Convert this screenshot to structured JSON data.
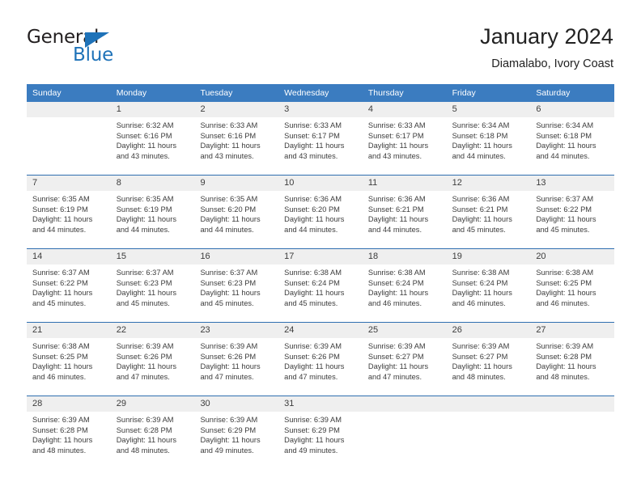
{
  "brand": {
    "name_part1": "General",
    "name_part2": "Blue",
    "accent_color": "#1e72b8"
  },
  "header": {
    "title": "January 2024",
    "subtitle": "Diamalabo, Ivory Coast"
  },
  "theme": {
    "header_blue": "#3b7cc0",
    "divider_blue": "#2f6fb0",
    "day_band_gray": "#efefef",
    "text_color": "#3c3c3c"
  },
  "weekdays": [
    "Sunday",
    "Monday",
    "Tuesday",
    "Wednesday",
    "Thursday",
    "Friday",
    "Saturday"
  ],
  "weeks": [
    [
      {
        "day": "",
        "sunrise": "",
        "sunset": "",
        "daylight_line1": "",
        "daylight_line2": ""
      },
      {
        "day": "1",
        "sunrise": "Sunrise: 6:32 AM",
        "sunset": "Sunset: 6:16 PM",
        "daylight_line1": "Daylight: 11 hours",
        "daylight_line2": "and 43 minutes."
      },
      {
        "day": "2",
        "sunrise": "Sunrise: 6:33 AM",
        "sunset": "Sunset: 6:16 PM",
        "daylight_line1": "Daylight: 11 hours",
        "daylight_line2": "and 43 minutes."
      },
      {
        "day": "3",
        "sunrise": "Sunrise: 6:33 AM",
        "sunset": "Sunset: 6:17 PM",
        "daylight_line1": "Daylight: 11 hours",
        "daylight_line2": "and 43 minutes."
      },
      {
        "day": "4",
        "sunrise": "Sunrise: 6:33 AM",
        "sunset": "Sunset: 6:17 PM",
        "daylight_line1": "Daylight: 11 hours",
        "daylight_line2": "and 43 minutes."
      },
      {
        "day": "5",
        "sunrise": "Sunrise: 6:34 AM",
        "sunset": "Sunset: 6:18 PM",
        "daylight_line1": "Daylight: 11 hours",
        "daylight_line2": "and 44 minutes."
      },
      {
        "day": "6",
        "sunrise": "Sunrise: 6:34 AM",
        "sunset": "Sunset: 6:18 PM",
        "daylight_line1": "Daylight: 11 hours",
        "daylight_line2": "and 44 minutes."
      }
    ],
    [
      {
        "day": "7",
        "sunrise": "Sunrise: 6:35 AM",
        "sunset": "Sunset: 6:19 PM",
        "daylight_line1": "Daylight: 11 hours",
        "daylight_line2": "and 44 minutes."
      },
      {
        "day": "8",
        "sunrise": "Sunrise: 6:35 AM",
        "sunset": "Sunset: 6:19 PM",
        "daylight_line1": "Daylight: 11 hours",
        "daylight_line2": "and 44 minutes."
      },
      {
        "day": "9",
        "sunrise": "Sunrise: 6:35 AM",
        "sunset": "Sunset: 6:20 PM",
        "daylight_line1": "Daylight: 11 hours",
        "daylight_line2": "and 44 minutes."
      },
      {
        "day": "10",
        "sunrise": "Sunrise: 6:36 AM",
        "sunset": "Sunset: 6:20 PM",
        "daylight_line1": "Daylight: 11 hours",
        "daylight_line2": "and 44 minutes."
      },
      {
        "day": "11",
        "sunrise": "Sunrise: 6:36 AM",
        "sunset": "Sunset: 6:21 PM",
        "daylight_line1": "Daylight: 11 hours",
        "daylight_line2": "and 44 minutes."
      },
      {
        "day": "12",
        "sunrise": "Sunrise: 6:36 AM",
        "sunset": "Sunset: 6:21 PM",
        "daylight_line1": "Daylight: 11 hours",
        "daylight_line2": "and 45 minutes."
      },
      {
        "day": "13",
        "sunrise": "Sunrise: 6:37 AM",
        "sunset": "Sunset: 6:22 PM",
        "daylight_line1": "Daylight: 11 hours",
        "daylight_line2": "and 45 minutes."
      }
    ],
    [
      {
        "day": "14",
        "sunrise": "Sunrise: 6:37 AM",
        "sunset": "Sunset: 6:22 PM",
        "daylight_line1": "Daylight: 11 hours",
        "daylight_line2": "and 45 minutes."
      },
      {
        "day": "15",
        "sunrise": "Sunrise: 6:37 AM",
        "sunset": "Sunset: 6:23 PM",
        "daylight_line1": "Daylight: 11 hours",
        "daylight_line2": "and 45 minutes."
      },
      {
        "day": "16",
        "sunrise": "Sunrise: 6:37 AM",
        "sunset": "Sunset: 6:23 PM",
        "daylight_line1": "Daylight: 11 hours",
        "daylight_line2": "and 45 minutes."
      },
      {
        "day": "17",
        "sunrise": "Sunrise: 6:38 AM",
        "sunset": "Sunset: 6:24 PM",
        "daylight_line1": "Daylight: 11 hours",
        "daylight_line2": "and 45 minutes."
      },
      {
        "day": "18",
        "sunrise": "Sunrise: 6:38 AM",
        "sunset": "Sunset: 6:24 PM",
        "daylight_line1": "Daylight: 11 hours",
        "daylight_line2": "and 46 minutes."
      },
      {
        "day": "19",
        "sunrise": "Sunrise: 6:38 AM",
        "sunset": "Sunset: 6:24 PM",
        "daylight_line1": "Daylight: 11 hours",
        "daylight_line2": "and 46 minutes."
      },
      {
        "day": "20",
        "sunrise": "Sunrise: 6:38 AM",
        "sunset": "Sunset: 6:25 PM",
        "daylight_line1": "Daylight: 11 hours",
        "daylight_line2": "and 46 minutes."
      }
    ],
    [
      {
        "day": "21",
        "sunrise": "Sunrise: 6:38 AM",
        "sunset": "Sunset: 6:25 PM",
        "daylight_line1": "Daylight: 11 hours",
        "daylight_line2": "and 46 minutes."
      },
      {
        "day": "22",
        "sunrise": "Sunrise: 6:39 AM",
        "sunset": "Sunset: 6:26 PM",
        "daylight_line1": "Daylight: 11 hours",
        "daylight_line2": "and 47 minutes."
      },
      {
        "day": "23",
        "sunrise": "Sunrise: 6:39 AM",
        "sunset": "Sunset: 6:26 PM",
        "daylight_line1": "Daylight: 11 hours",
        "daylight_line2": "and 47 minutes."
      },
      {
        "day": "24",
        "sunrise": "Sunrise: 6:39 AM",
        "sunset": "Sunset: 6:26 PM",
        "daylight_line1": "Daylight: 11 hours",
        "daylight_line2": "and 47 minutes."
      },
      {
        "day": "25",
        "sunrise": "Sunrise: 6:39 AM",
        "sunset": "Sunset: 6:27 PM",
        "daylight_line1": "Daylight: 11 hours",
        "daylight_line2": "and 47 minutes."
      },
      {
        "day": "26",
        "sunrise": "Sunrise: 6:39 AM",
        "sunset": "Sunset: 6:27 PM",
        "daylight_line1": "Daylight: 11 hours",
        "daylight_line2": "and 48 minutes."
      },
      {
        "day": "27",
        "sunrise": "Sunrise: 6:39 AM",
        "sunset": "Sunset: 6:28 PM",
        "daylight_line1": "Daylight: 11 hours",
        "daylight_line2": "and 48 minutes."
      }
    ],
    [
      {
        "day": "28",
        "sunrise": "Sunrise: 6:39 AM",
        "sunset": "Sunset: 6:28 PM",
        "daylight_line1": "Daylight: 11 hours",
        "daylight_line2": "and 48 minutes."
      },
      {
        "day": "29",
        "sunrise": "Sunrise: 6:39 AM",
        "sunset": "Sunset: 6:28 PM",
        "daylight_line1": "Daylight: 11 hours",
        "daylight_line2": "and 48 minutes."
      },
      {
        "day": "30",
        "sunrise": "Sunrise: 6:39 AM",
        "sunset": "Sunset: 6:29 PM",
        "daylight_line1": "Daylight: 11 hours",
        "daylight_line2": "and 49 minutes."
      },
      {
        "day": "31",
        "sunrise": "Sunrise: 6:39 AM",
        "sunset": "Sunset: 6:29 PM",
        "daylight_line1": "Daylight: 11 hours",
        "daylight_line2": "and 49 minutes."
      },
      {
        "day": "",
        "sunrise": "",
        "sunset": "",
        "daylight_line1": "",
        "daylight_line2": ""
      },
      {
        "day": "",
        "sunrise": "",
        "sunset": "",
        "daylight_line1": "",
        "daylight_line2": ""
      },
      {
        "day": "",
        "sunrise": "",
        "sunset": "",
        "daylight_line1": "",
        "daylight_line2": ""
      }
    ]
  ]
}
